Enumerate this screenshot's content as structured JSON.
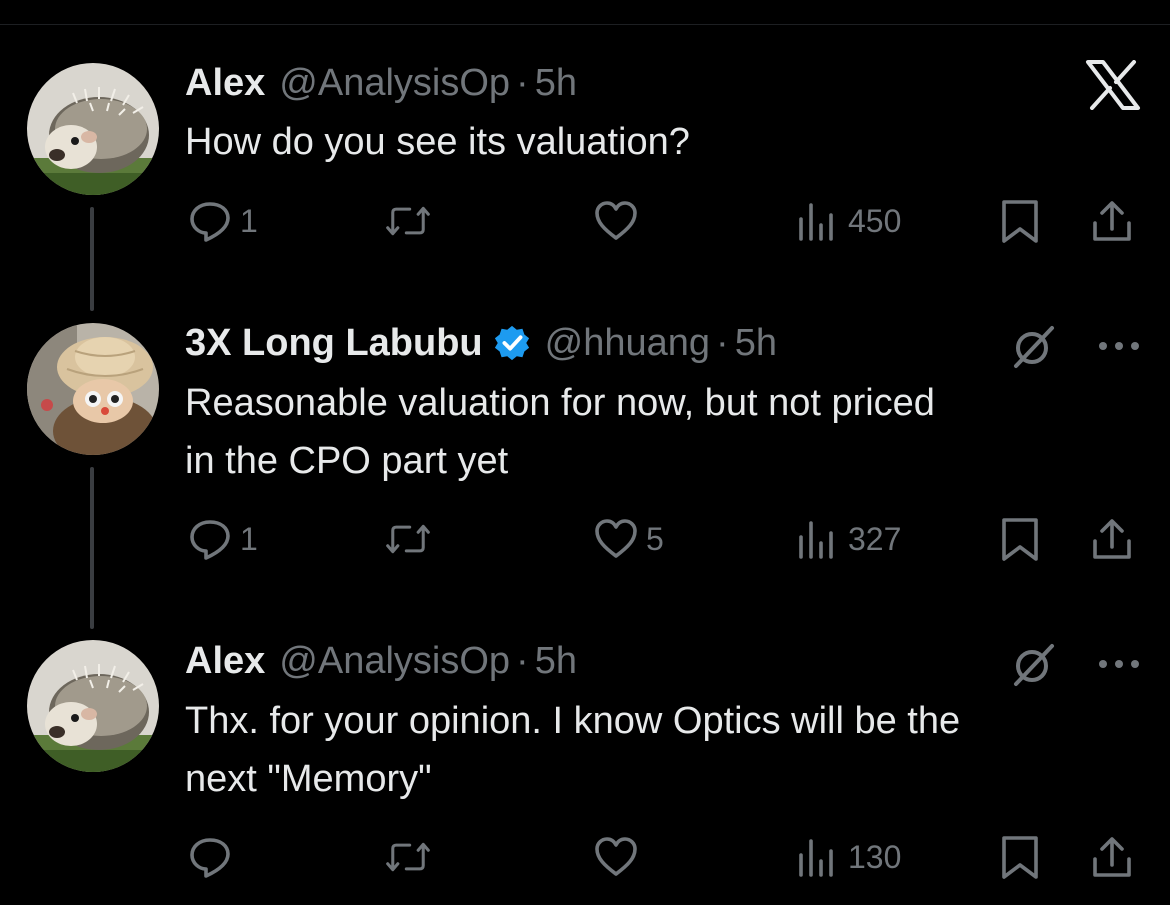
{
  "tweets": [
    {
      "name": "Alex",
      "handle": "@AnalysisOp",
      "time": "5h",
      "text": "How do you see its valuation?",
      "replies": "1",
      "retweets": "",
      "likes": "",
      "views": "450",
      "verified": false
    },
    {
      "name": "3X Long Labubu",
      "handle": "@hhuang",
      "time": "5h",
      "text_line1": "Reasonable valuation for now, but not priced",
      "text_line2": "in the CPO part yet",
      "replies": "1",
      "retweets": "",
      "likes": "5",
      "views": "327",
      "verified": true
    },
    {
      "name": "Alex",
      "handle": "@AnalysisOp",
      "time": "5h",
      "text_line1": "Thx. for your opinion. I know Optics will be the",
      "text_line2": "next \"Memory\"",
      "replies": "",
      "retweets": "",
      "likes": "",
      "views": "130",
      "verified": false
    }
  ],
  "separator": "·",
  "colors": {
    "background": "#000000",
    "text": "#e7e9ea",
    "secondary": "#71767b",
    "verified_blue": "#1d9bf0",
    "thread_line": "#3a3d41"
  },
  "icons": [
    "x-logo-icon",
    "grok-icon",
    "more-icon",
    "reply-icon",
    "retweet-icon",
    "like-icon",
    "views-icon",
    "bookmark-icon",
    "share-icon",
    "verified-badge-icon"
  ]
}
